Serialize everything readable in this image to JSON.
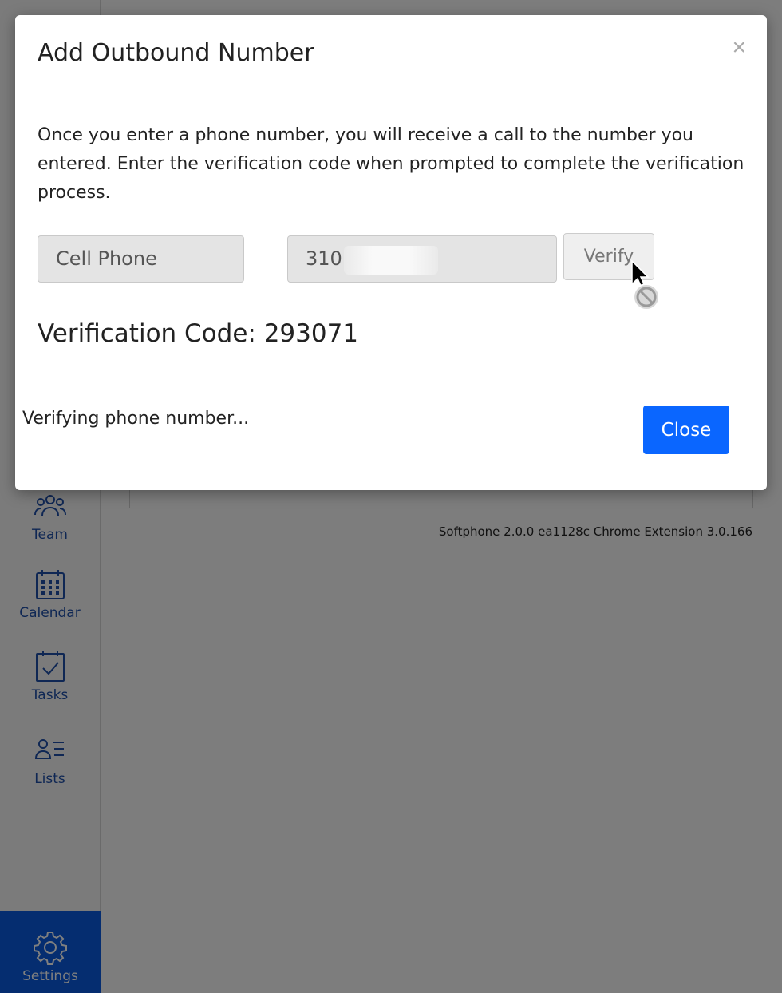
{
  "sidebar": {
    "items": [
      {
        "label": "Team",
        "icon": "team-icon"
      },
      {
        "label": "Calendar",
        "icon": "calendar-icon"
      },
      {
        "label": "Tasks",
        "icon": "tasks-icon"
      },
      {
        "label": "Lists",
        "icon": "lists-icon"
      }
    ],
    "settings": {
      "label": "Settings",
      "icon": "gear-icon"
    }
  },
  "footer": {
    "version": "Softphone 2.0.0 ea1128c Chrome Extension 3.0.166"
  },
  "modal": {
    "title": "Add Outbound Number",
    "close_symbol": "×",
    "description": "Once you enter a phone number, you will receive a call to the number you entered. Enter the verification code when prompted to complete the verification process.",
    "phone_type": "Cell Phone",
    "phone_number_visible": "310",
    "verify_label": "Verify",
    "verification_code_text": "Verification Code: 293071",
    "status": "Verifying phone number...",
    "close_label": "Close"
  },
  "colors": {
    "accent": "#0a66ff",
    "sidebar_text": "#1f4fa8",
    "settings_bg": "#0a5ae0"
  }
}
